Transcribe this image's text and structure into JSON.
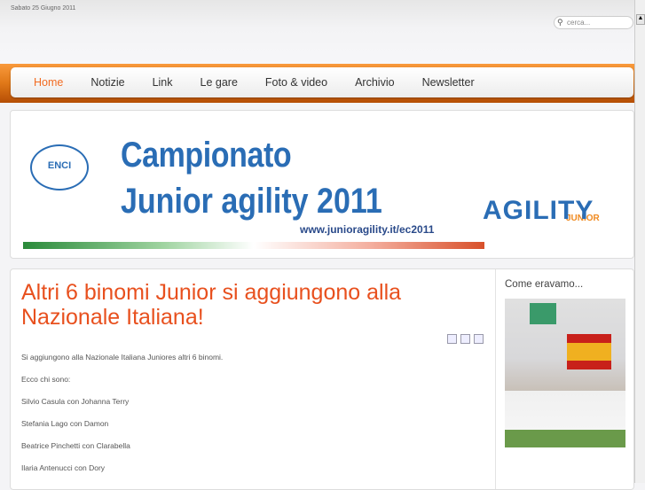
{
  "header": {
    "date": "Sabato 25 Giugno 2011",
    "search_placeholder": "cerca..."
  },
  "nav": [
    {
      "label": "Home",
      "active": true
    },
    {
      "label": "Notizie"
    },
    {
      "label": "Link"
    },
    {
      "label": "Le gare"
    },
    {
      "label": "Foto & video"
    },
    {
      "label": "Archivio"
    },
    {
      "label": "Newsletter"
    }
  ],
  "banner": {
    "line1": "Campionato",
    "line2": "Junior agility 2011",
    "url": "www.junioragility.it/ec2011",
    "logo_enci": "ENCI",
    "logo_junior": "JUNIOR",
    "logo_agility": "AGILITY"
  },
  "article": {
    "title": "Altri 6 binomi Junior si aggiungono alla Nazionale Italiana!",
    "paragraphs": [
      "Si aggiungono alla Nazionale Italiana Juniores altri 6 binomi.",
      "Ecco chi sono:",
      "Silvio Casula con Johanna Terry",
      "Stefania Lago con Damon",
      "Beatrice Pinchetti con Clarabella",
      "Ilaria Antenucci con Dory"
    ]
  },
  "sidebar": {
    "title": "Come eravamo..."
  },
  "colors": {
    "accent": "#e8501e",
    "nav_orange": "#e07818",
    "brand_blue": "#2a6db5"
  }
}
